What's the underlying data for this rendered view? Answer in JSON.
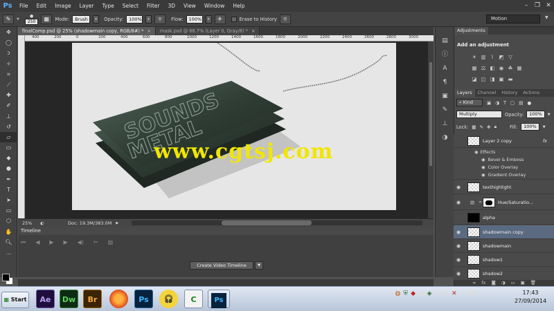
{
  "menubar": {
    "logo": "Ps",
    "items": [
      "File",
      "Edit",
      "Image",
      "Layer",
      "Type",
      "Select",
      "Filter",
      "3D",
      "View",
      "Window",
      "Help"
    ]
  },
  "options": {
    "brush_size": "250",
    "mode_label": "Mode:",
    "mode_value": "Brush",
    "opacity_label": "Opacity:",
    "opacity_value": "100%",
    "flow_label": "Flow:",
    "flow_value": "100%",
    "erase_history": "Erase to History",
    "workspace": "Motion"
  },
  "tabs": [
    {
      "label": "finalComp.psd @ 25% (shadowmain copy, RGB/8#) *",
      "active": true
    },
    {
      "label": "mask.psd @ 66.7% (Layer 0, Gray/8) *",
      "active": false
    }
  ],
  "ruler": [
    "400",
    "200",
    "0",
    "200",
    "400",
    "600",
    "800",
    "1000",
    "1200",
    "1400",
    "1600",
    "1800",
    "2000",
    "2200",
    "2400",
    "2600",
    "2800",
    "3000"
  ],
  "canvas": {
    "watermark": "www.cgtsj.com"
  },
  "status": {
    "zoom": "25%",
    "doc": "Doc: 19.3M/383.0M"
  },
  "timeline": {
    "title": "Timeline",
    "create_button": "Create Video Timeline"
  },
  "adjustments": {
    "tab": "Adjustments",
    "heading": "Add an adjustment"
  },
  "layers_panel": {
    "tabs": [
      "Layers",
      "Channel",
      "History",
      "Actions"
    ],
    "kind": "Kind",
    "blend_mode": "Multiply",
    "opacity_label": "Opacity:",
    "opacity_value": "100%",
    "lock_label": "Lock:",
    "fill_label": "Fill:",
    "fill_value": "100%",
    "effects_label": "Effects",
    "effects": [
      "Bevel & Emboss",
      "Color Overlay",
      "Gradient Overlay"
    ],
    "layers": [
      {
        "name": "Layer 2 copy",
        "visible": false,
        "selected": false
      },
      {
        "name": "texthighlight",
        "visible": true,
        "selected": false
      },
      {
        "name": "Hue/Saturatio...",
        "visible": true,
        "selected": false
      },
      {
        "name": "alpha",
        "visible": false,
        "selected": false
      },
      {
        "name": "shadowmain copy",
        "visible": true,
        "selected": true
      },
      {
        "name": "shadowmain",
        "visible": true,
        "selected": false
      },
      {
        "name": "shadow1",
        "visible": true,
        "selected": false
      },
      {
        "name": "shadow2",
        "visible": true,
        "selected": false
      }
    ],
    "fx_badge": "fx"
  },
  "taskbar": {
    "start": "Start",
    "apps": [
      "Ae",
      "Dw",
      "Br",
      "Ps",
      "Ps"
    ],
    "time": "17:43",
    "date": "27/09/2014"
  },
  "colors": {
    "ui_dark": "#3a3a3a",
    "ui_panel": "#4a4a4a",
    "selection": "#5a6a80",
    "watermark": "#f2e600"
  }
}
